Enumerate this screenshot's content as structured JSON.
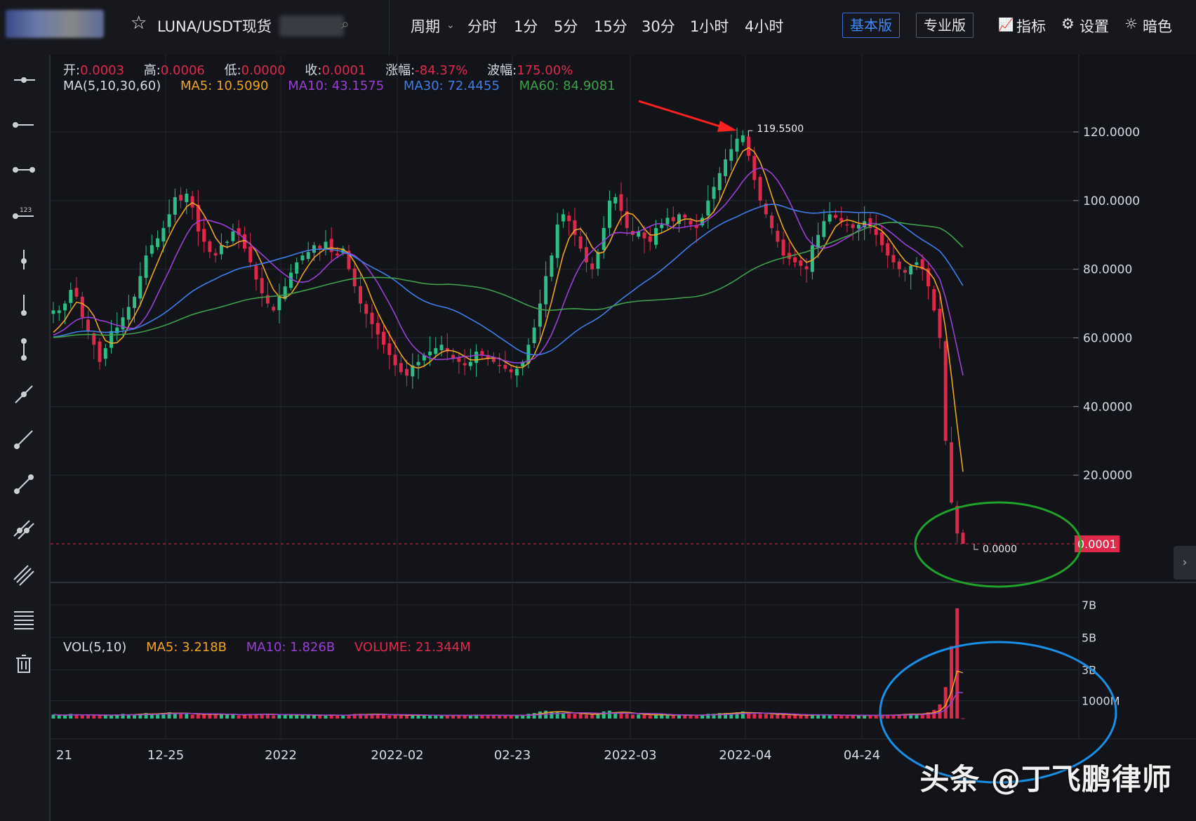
{
  "header": {
    "symbol": "LUNA/USDT现货",
    "period_label": "周期",
    "timeframes": [
      "分时",
      "1分",
      "5分",
      "15分",
      "30分",
      "1小时",
      "4小时"
    ],
    "basic_version": "基本版",
    "pro_version": "专业版",
    "indicators": "指标",
    "settings": "设置",
    "theme": "暗色"
  },
  "sidebar": {
    "tools": [
      "horizontal-ray-icon",
      "horizontal-line-icon",
      "horizontal-segment-icon",
      "price-line-icon",
      "vertical-ray-icon",
      "vertical-line-icon",
      "vertical-segment-icon",
      "trend-ray-icon",
      "trend-line-icon",
      "trend-segment-icon",
      "parallel-channel-icon",
      "multi-parallel-icon",
      "fibonacci-icon",
      "delete-icon"
    ]
  },
  "ohlc_legend": {
    "open_label": "开:",
    "open": "0.0003",
    "high_label": "高:",
    "high": "0.0006",
    "low_label": "低:",
    "low": "0.0000",
    "close_label": "收:",
    "close": "0.0001",
    "change_label": "涨幅:",
    "change": "-84.37%",
    "amplitude_label": "波幅:",
    "amplitude": "175.00%"
  },
  "ma_legend": {
    "title": "MA(5,10,30,60)",
    "ma5": "MA5: 10.5090",
    "ma10": "MA10: 43.1575",
    "ma30": "MA30: 72.4455",
    "ma60": "MA60: 84.9081"
  },
  "vol_legend": {
    "title": "VOL(5,10)",
    "ma5": "MA5: 3.218B",
    "ma10": "MA10: 1.826B",
    "volume": "VOLUME: 21.344M"
  },
  "annotations": {
    "high_marker": "119.5500",
    "low_marker": "0.0000",
    "last_price": "0.0001"
  },
  "watermark": "头条 @丁飞鹏律师",
  "colors": {
    "up": "#2ebd85",
    "down": "#e0294a",
    "ma5": "#f0a422",
    "ma10": "#9b3fd6",
    "ma30": "#3f7ee8",
    "ma60": "#3fa14a",
    "arrow": "#ff2020",
    "green_circle": "#1fa32a",
    "blue_circle": "#1a8fe8"
  },
  "chart_data": {
    "type": "candlestick",
    "price_axis": {
      "ticks": [
        20,
        40,
        60,
        80,
        100,
        120
      ],
      "tick_labels": [
        "20.0000",
        "40.0000",
        "60.0000",
        "80.0000",
        "100.0000",
        "120.0000"
      ],
      "range": [
        0,
        120
      ]
    },
    "volume_axis": {
      "tick_labels": [
        "1000M",
        "3B",
        "5B",
        "7B"
      ],
      "ticks": [
        1,
        3,
        5,
        7
      ],
      "unit": "B"
    },
    "x_tick_labels": [
      "21",
      "12-25",
      "2022",
      "2022-02",
      "02-23",
      "2022-03",
      "2022-04",
      "04-24"
    ],
    "grid": true,
    "candles_close": [
      68,
      68,
      70,
      74,
      72,
      66,
      62,
      58,
      53,
      57,
      62,
      63,
      66,
      69,
      72,
      78,
      84,
      87,
      89,
      92,
      96,
      101,
      100,
      102,
      98,
      91,
      88,
      85,
      84,
      87,
      88,
      91,
      90,
      86,
      82,
      77,
      73,
      70,
      68,
      72,
      75,
      79,
      82,
      84,
      85,
      87,
      86,
      88,
      85,
      84,
      86,
      80,
      75,
      70,
      67,
      64,
      61,
      58,
      55,
      52,
      50,
      49,
      52,
      53,
      55,
      56,
      57,
      58,
      56,
      54,
      53,
      52,
      53,
      56,
      55,
      54,
      53,
      52,
      51,
      50,
      51,
      53,
      58,
      63,
      70,
      78,
      84,
      93,
      96,
      94,
      90,
      86,
      82,
      80,
      85,
      92,
      100,
      101,
      97,
      92,
      90,
      91,
      89,
      88,
      92,
      93,
      95,
      94,
      96,
      95,
      93,
      92,
      95,
      100,
      104,
      108,
      112,
      115,
      118,
      119,
      113,
      106,
      100,
      96,
      92,
      88,
      84,
      83,
      82,
      81,
      80,
      87,
      90,
      94,
      96,
      95,
      94,
      93,
      92,
      93,
      94,
      92,
      90,
      87,
      84,
      82,
      80,
      79,
      81,
      82,
      80,
      75,
      68,
      60,
      30,
      12,
      3,
      0.0001
    ],
    "ma5_label": "MA5",
    "ma10_label": "MA10",
    "ma30_label": "MA30",
    "ma60_label": "MA60",
    "volumes_b": [
      0.25,
      0.2,
      0.2,
      0.3,
      0.25,
      0.2,
      0.2,
      0.25,
      0.2,
      0.2,
      0.2,
      0.25,
      0.3,
      0.25,
      0.25,
      0.3,
      0.35,
      0.3,
      0.3,
      0.35,
      0.4,
      0.35,
      0.3,
      0.3,
      0.25,
      0.25,
      0.25,
      0.3,
      0.3,
      0.25,
      0.25,
      0.25,
      0.2,
      0.25,
      0.3,
      0.3,
      0.3,
      0.25,
      0.2,
      0.25,
      0.25,
      0.25,
      0.2,
      0.2,
      0.25,
      0.2,
      0.2,
      0.2,
      0.25,
      0.2,
      0.2,
      0.25,
      0.3,
      0.3,
      0.25,
      0.25,
      0.3,
      0.25,
      0.2,
      0.2,
      0.2,
      0.2,
      0.25,
      0.2,
      0.2,
      0.2,
      0.2,
      0.2,
      0.2,
      0.2,
      0.2,
      0.2,
      0.2,
      0.25,
      0.2,
      0.2,
      0.2,
      0.2,
      0.2,
      0.2,
      0.2,
      0.2,
      0.3,
      0.35,
      0.45,
      0.5,
      0.45,
      0.4,
      0.35,
      0.3,
      0.3,
      0.3,
      0.25,
      0.25,
      0.3,
      0.45,
      0.5,
      0.4,
      0.35,
      0.3,
      0.25,
      0.25,
      0.25,
      0.2,
      0.25,
      0.25,
      0.2,
      0.2,
      0.25,
      0.2,
      0.2,
      0.2,
      0.25,
      0.3,
      0.3,
      0.35,
      0.35,
      0.35,
      0.4,
      0.45,
      0.35,
      0.3,
      0.3,
      0.3,
      0.25,
      0.25,
      0.25,
      0.2,
      0.2,
      0.25,
      0.2,
      0.25,
      0.25,
      0.25,
      0.2,
      0.2,
      0.2,
      0.2,
      0.2,
      0.2,
      0.2,
      0.2,
      0.2,
      0.2,
      0.25,
      0.25,
      0.25,
      0.3,
      0.3,
      0.3,
      0.3,
      0.4,
      0.55,
      0.9,
      2.0,
      4.6,
      7.0,
      0.02
    ]
  }
}
